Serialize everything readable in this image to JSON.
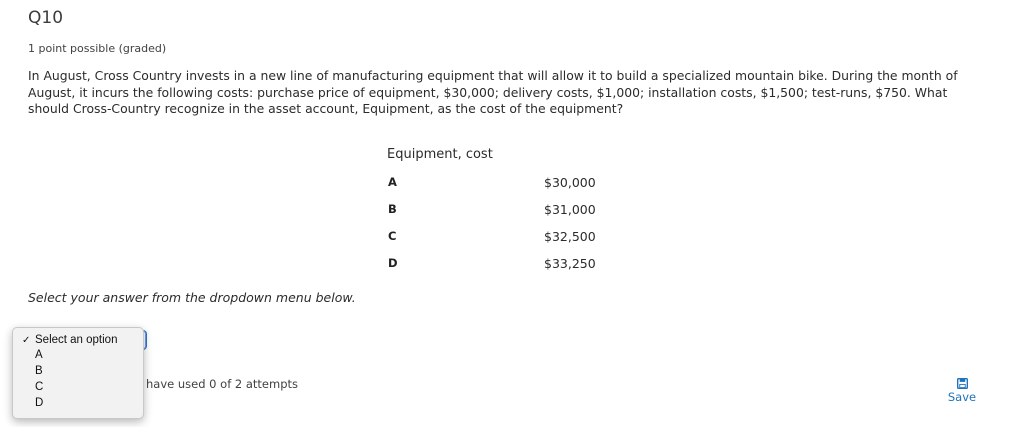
{
  "problem": {
    "title": "Q10",
    "points": "1 point possible (graded)",
    "question": "In August, Cross Country invests in a new line of manufacturing equipment that will allow it to build a specialized mountain bike. During the month of August, it incurs the following costs: purchase price of equipment, $30,000; delivery costs, $1,000; installation costs, $1,500; test-runs, $750. What should Cross-Country recognize in the asset account, Equipment, as the cost of the equipment?"
  },
  "options_table": {
    "header": "Equipment, cost",
    "rows": [
      {
        "letter": "A",
        "value": "$30,000"
      },
      {
        "letter": "B",
        "value": "$31,000"
      },
      {
        "letter": "C",
        "value": "$32,500"
      },
      {
        "letter": "D",
        "value": "$33,250"
      }
    ]
  },
  "instruction": "Select your answer from the dropdown menu below.",
  "dropdown": {
    "items": [
      {
        "label": "Select an option",
        "checked": true
      },
      {
        "label": "A",
        "checked": false
      },
      {
        "label": "B",
        "checked": false
      },
      {
        "label": "C",
        "checked": false
      },
      {
        "label": "D",
        "checked": false
      }
    ],
    "check_glyph": "✓"
  },
  "attempts_text": "have used 0 of 2 attempts",
  "save": {
    "label": "Save",
    "icon": "floppy-disk-icon"
  }
}
